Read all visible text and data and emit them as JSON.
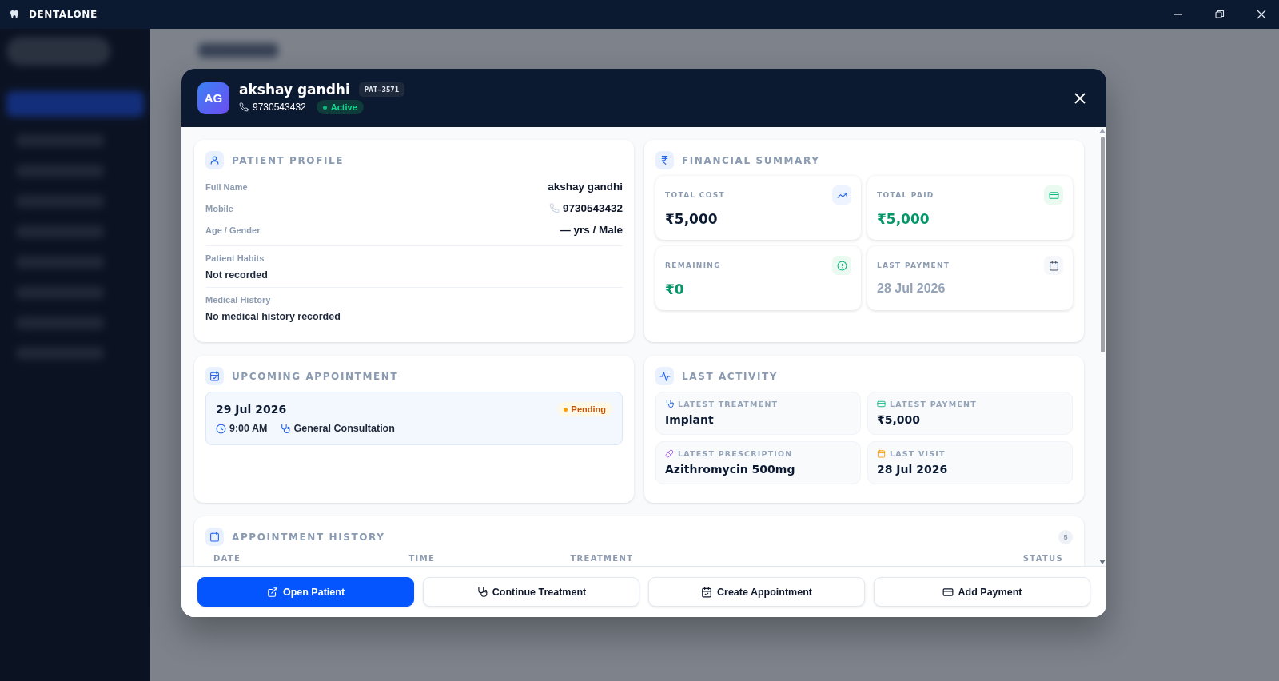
{
  "app": {
    "title": "DENTALONE"
  },
  "patient": {
    "initials": "AG",
    "name": "akshay gandhi",
    "id": "PAT-3571",
    "phone": "9730543432",
    "status": {
      "label": "Active",
      "color": "#10b981"
    }
  },
  "profile": {
    "title": "PATIENT PROFILE",
    "rows": [
      {
        "label": "Full Name",
        "value": "akshay gandhi",
        "kind": "text"
      },
      {
        "label": "Mobile",
        "value": "9730543432",
        "kind": "phone"
      },
      {
        "label": "Age / Gender",
        "value": "— yrs / Male",
        "kind": "text"
      }
    ],
    "blocks": [
      {
        "label": "Patient Habits",
        "value": "Not recorded"
      },
      {
        "label": "Medical History",
        "value": "No medical history recorded"
      }
    ]
  },
  "financial": {
    "title": "FINANCIAL SUMMARY",
    "tiles": [
      {
        "label": "TOTAL COST",
        "value": "₹5,000",
        "kind": "cost"
      },
      {
        "label": "TOTAL PAID",
        "value": "₹5,000",
        "kind": "paid"
      },
      {
        "label": "REMAINING",
        "value": "₹0",
        "kind": "remaining"
      },
      {
        "label": "LAST PAYMENT",
        "value": "28 Jul 2026",
        "kind": "last_payment"
      }
    ]
  },
  "upcoming": {
    "title": "UPCOMING APPOINTMENT",
    "date": "29 Jul 2026",
    "time": "9:00 AM",
    "treatment": "General Consultation",
    "status": {
      "label": "Pending",
      "color": "#f59e0b"
    }
  },
  "activity": {
    "title": "LAST ACTIVITY",
    "items": [
      {
        "label": "LATEST TREATMENT",
        "value": "Implant",
        "kind": "treatment"
      },
      {
        "label": "LATEST PAYMENT",
        "value": "₹5,000",
        "kind": "payment"
      },
      {
        "label": "LATEST PRESCRIPTION",
        "value": "Azithromycin 500mg",
        "kind": "prescription"
      },
      {
        "label": "LAST VISIT",
        "value": "28 Jul 2026",
        "kind": "visit"
      }
    ]
  },
  "history": {
    "title": "APPOINTMENT HISTORY",
    "count": "5",
    "columns": [
      "DATE",
      "TIME",
      "TREATMENT",
      "STATUS"
    ]
  },
  "actions": [
    {
      "label": "Open Patient",
      "kind": "open",
      "primary": true
    },
    {
      "label": "Continue Treatment",
      "kind": "treatment",
      "primary": false
    },
    {
      "label": "Create Appointment",
      "kind": "appointment",
      "primary": false
    },
    {
      "label": "Add Payment",
      "kind": "payment",
      "primary": false
    }
  ]
}
